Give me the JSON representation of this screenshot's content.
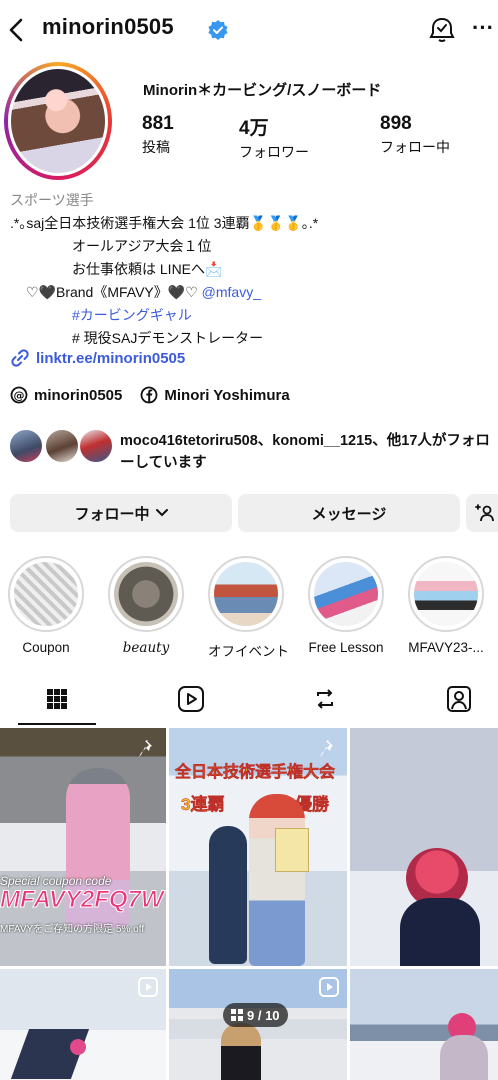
{
  "header": {
    "username": "minorin0505",
    "back_icon": "chevron-left-icon",
    "verified_icon": "verified-badge-icon",
    "threads_icon": "threads-icon",
    "more_icon": "more-horizontal-icon"
  },
  "profile": {
    "display_name": "Minorin＊カービング/スノーボード",
    "stats": [
      {
        "value": "881",
        "label": "投稿"
      },
      {
        "value": "4万",
        "label": "フォロワー"
      },
      {
        "value": "898",
        "label": "フォロー中"
      }
    ],
    "category": "スポーツ選手",
    "bio": {
      "line1": ".*｡saj全日本技術選手権大会 1位  3連覇🥇🥇🥇｡.*",
      "line2": "オールアジア大会１位",
      "line3": "お仕事依頼は LINEへ📩",
      "line4_prefix": "♡🖤Brand《MFAVY》🖤♡ ",
      "line4_mention": "@mfavy_",
      "line5_hashtag": "#カービングギャル",
      "line6": "# 現役SAJデモンストレーター"
    },
    "link": "linktr.ee/minorin0505",
    "threads_handle": "minorin0505",
    "facebook_name": "Minori Yoshimura",
    "followed_by": "moco416tetoriru508、konomi__1215、他17人がフォローしています"
  },
  "actions": {
    "following_label": "フォロー中",
    "message_label": "メッセージ",
    "add_user_icon": "add-person-icon"
  },
  "highlights": [
    {
      "label": "Coupon"
    },
    {
      "label": "beauty"
    },
    {
      "label": "オフイベント"
    },
    {
      "label": "Free Lesson"
    },
    {
      "label": "MFAVY23-..."
    }
  ],
  "tabs": [
    {
      "icon": "grid-icon",
      "selected": true
    },
    {
      "icon": "reels-icon",
      "selected": false
    },
    {
      "icon": "repost-icon",
      "selected": false
    },
    {
      "icon": "tagged-icon",
      "selected": false
    }
  ],
  "posts": {
    "post1": {
      "coupon_caption": "Special coupon code",
      "code": "MFAVY2FQ7W",
      "sub_caption": "MFAVYをご存知の方限定 5% off"
    },
    "post2": {
      "title": "全日本技術選手権大会",
      "left_caption": "3連覇",
      "right_caption": "優勝"
    },
    "carousel_counter": "9 / 10"
  },
  "colors": {
    "link_blue": "#3b5bdb",
    "verified_blue": "#3897f0",
    "button_bg": "#efefef"
  }
}
